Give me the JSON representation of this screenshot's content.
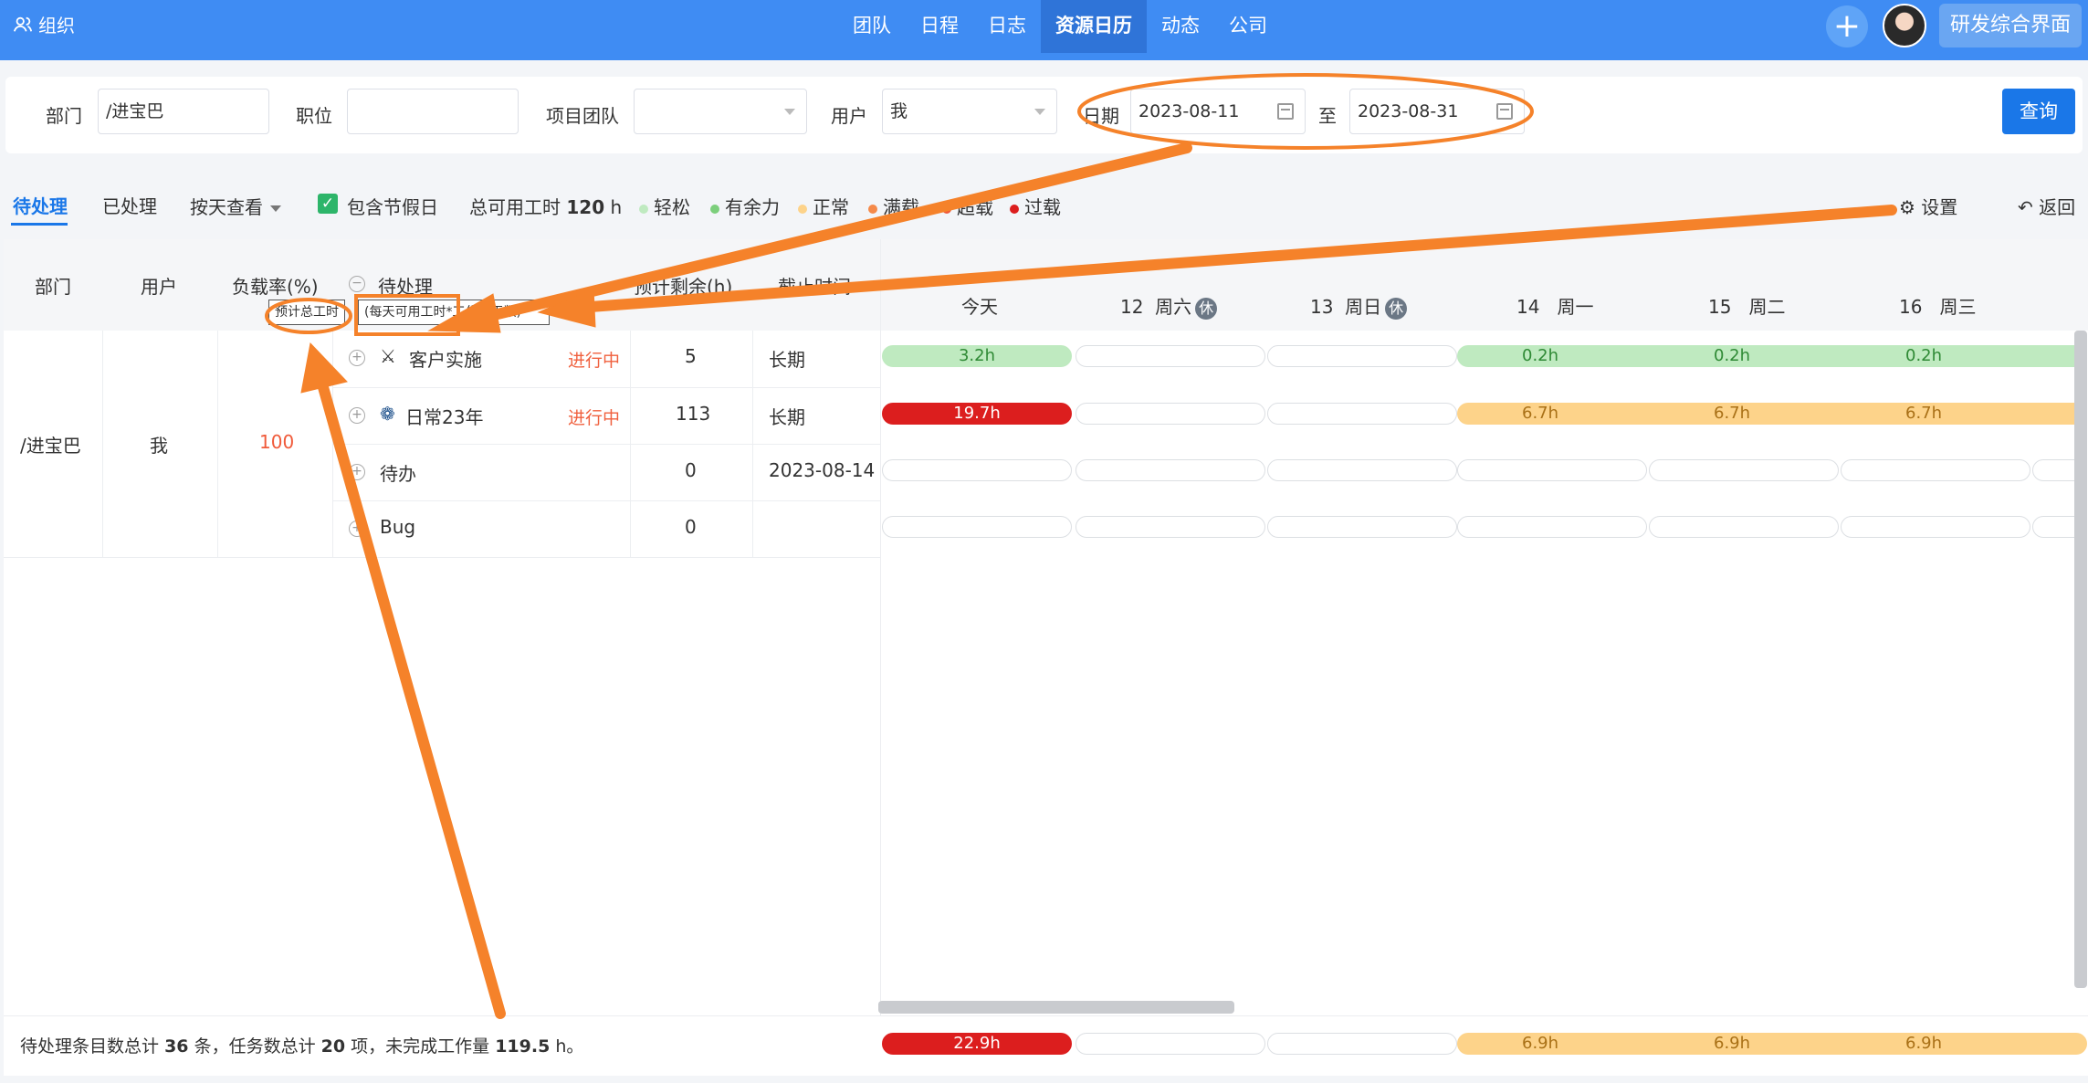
{
  "topbar": {
    "org_label": "组织",
    "nav": [
      "团队",
      "日程",
      "日志",
      "资源日历",
      "动态",
      "公司"
    ],
    "active_nav": "资源日历",
    "rd_button": "研发综合界面",
    "accent": "#3f8cf3"
  },
  "filters": {
    "dept_label": "部门",
    "dept_value": "/进宝巴",
    "position_label": "职位",
    "position_value": "",
    "team_label": "项目团队",
    "team_value": "",
    "user_label": "用户",
    "user_value": "我",
    "date_label": "日期",
    "date_from": "2023-08-11",
    "date_to_label": "至",
    "date_to": "2023-08-31",
    "query_button": "查询"
  },
  "toolbar": {
    "tab_pending": "待处理",
    "tab_done": "已处理",
    "view_by": "按天查看",
    "include_holiday": "包含节假日",
    "total_label": "总可用工时",
    "total_value": "120",
    "total_unit": "h",
    "legend": [
      {
        "label": "轻松",
        "color": "#bfeac0"
      },
      {
        "label": "有余力",
        "color": "#7ccf7c"
      },
      {
        "label": "正常",
        "color": "#fdd38a"
      },
      {
        "label": "满载",
        "color": "#f58a4a"
      },
      {
        "label": "超载",
        "color": "#f05a3a"
      },
      {
        "label": "过载",
        "color": "#dc1e1e"
      }
    ],
    "settings": "设置",
    "back": "返回"
  },
  "table": {
    "headers": {
      "dept": "部门",
      "user": "用户",
      "load": "负载率(%)",
      "pending": "待处理",
      "remaining": "预计剩余(h)",
      "deadline": "截止时间"
    },
    "hint_total": "预计总工时",
    "hint_formula": "(每天可用工时*工作日天数)",
    "dept": "/进宝巴",
    "user": "我",
    "load": "100",
    "rows": [
      {
        "name": "客户实施",
        "status": "进行中",
        "remaining": "5",
        "deadline": "长期",
        "bars": [
          "3.2h",
          "",
          "",
          "0.2h",
          "0.2h",
          "0.2h"
        ]
      },
      {
        "name": "日常23年",
        "status": "进行中",
        "remaining": "113",
        "deadline": "长期",
        "bars": [
          "19.7h",
          "",
          "",
          "6.7h",
          "6.7h",
          "6.7h"
        ]
      },
      {
        "name": "待办",
        "status": "",
        "remaining": "0",
        "deadline": "2023-08-14",
        "bars": [
          "",
          "",
          "",
          "",
          "",
          ""
        ]
      },
      {
        "name": "Bug",
        "status": "",
        "remaining": "0",
        "deadline": "",
        "bars": [
          "",
          "",
          "",
          "",
          "",
          ""
        ]
      }
    ],
    "days": [
      {
        "num": "",
        "label": "今天",
        "rest": ""
      },
      {
        "num": "12",
        "label": "周六",
        "rest": "休"
      },
      {
        "num": "13",
        "label": "周日",
        "rest": "休"
      },
      {
        "num": "14",
        "label": "周一",
        "rest": ""
      },
      {
        "num": "15",
        "label": "周二",
        "rest": ""
      },
      {
        "num": "16",
        "label": "周三",
        "rest": ""
      }
    ],
    "footer_bars": [
      "22.9h",
      "",
      "",
      "6.9h",
      "6.9h",
      "6.9h"
    ]
  },
  "footer": {
    "p1": "待处理条目数总计",
    "items": "36",
    "p2": "条，任务数总计",
    "tasks": "20",
    "p3": "项，未完成工作量",
    "work": "119.5",
    "p4": "h。"
  }
}
